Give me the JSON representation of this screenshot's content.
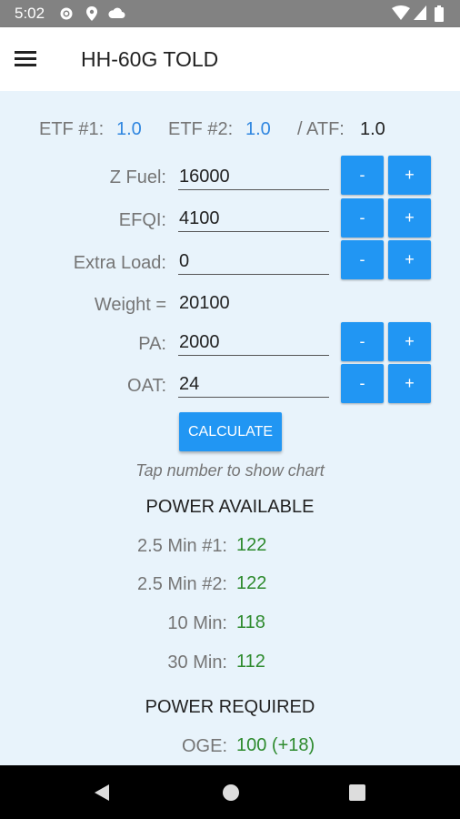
{
  "status_bar": {
    "time": "5:02"
  },
  "app_bar": {
    "title": "HH-60G TOLD"
  },
  "etf": {
    "etf1_label": "ETF #1:",
    "etf1_value": "1.0",
    "etf2_label": "ETF #2:",
    "etf2_value": "1.0",
    "atf_label": "/ ATF:",
    "atf_value": "1.0"
  },
  "fields": {
    "zfuel": {
      "label": "Z Fuel:",
      "value": "16000"
    },
    "efqi": {
      "label": "EFQI:",
      "value": "4100"
    },
    "extra_load": {
      "label": "Extra Load:",
      "value": "0"
    },
    "weight": {
      "label": "Weight =",
      "value": "20100"
    },
    "pa": {
      "label": "PA:",
      "value": "2000"
    },
    "oat": {
      "label": "OAT:",
      "value": "24"
    }
  },
  "buttons": {
    "minus": "-",
    "plus": "+",
    "calculate": "CALCULATE"
  },
  "hint": "Tap number to show chart",
  "power_available": {
    "title": "POWER AVAILABLE",
    "rows": [
      {
        "label": "2.5 Min #1:",
        "value": "122"
      },
      {
        "label": "2.5 Min #2:",
        "value": "122"
      },
      {
        "label": "10 Min:",
        "value": "118"
      },
      {
        "label": "30 Min:",
        "value": "112"
      }
    ]
  },
  "power_required": {
    "title": "POWER REQUIRED",
    "rows": [
      {
        "label": "OGE:",
        "value": "100 (+18)"
      }
    ]
  },
  "colors": {
    "accent_button": "#2196f3",
    "value_blue": "#2f86e0",
    "value_green": "#2d8a2d",
    "background": "#e8f3fb"
  }
}
